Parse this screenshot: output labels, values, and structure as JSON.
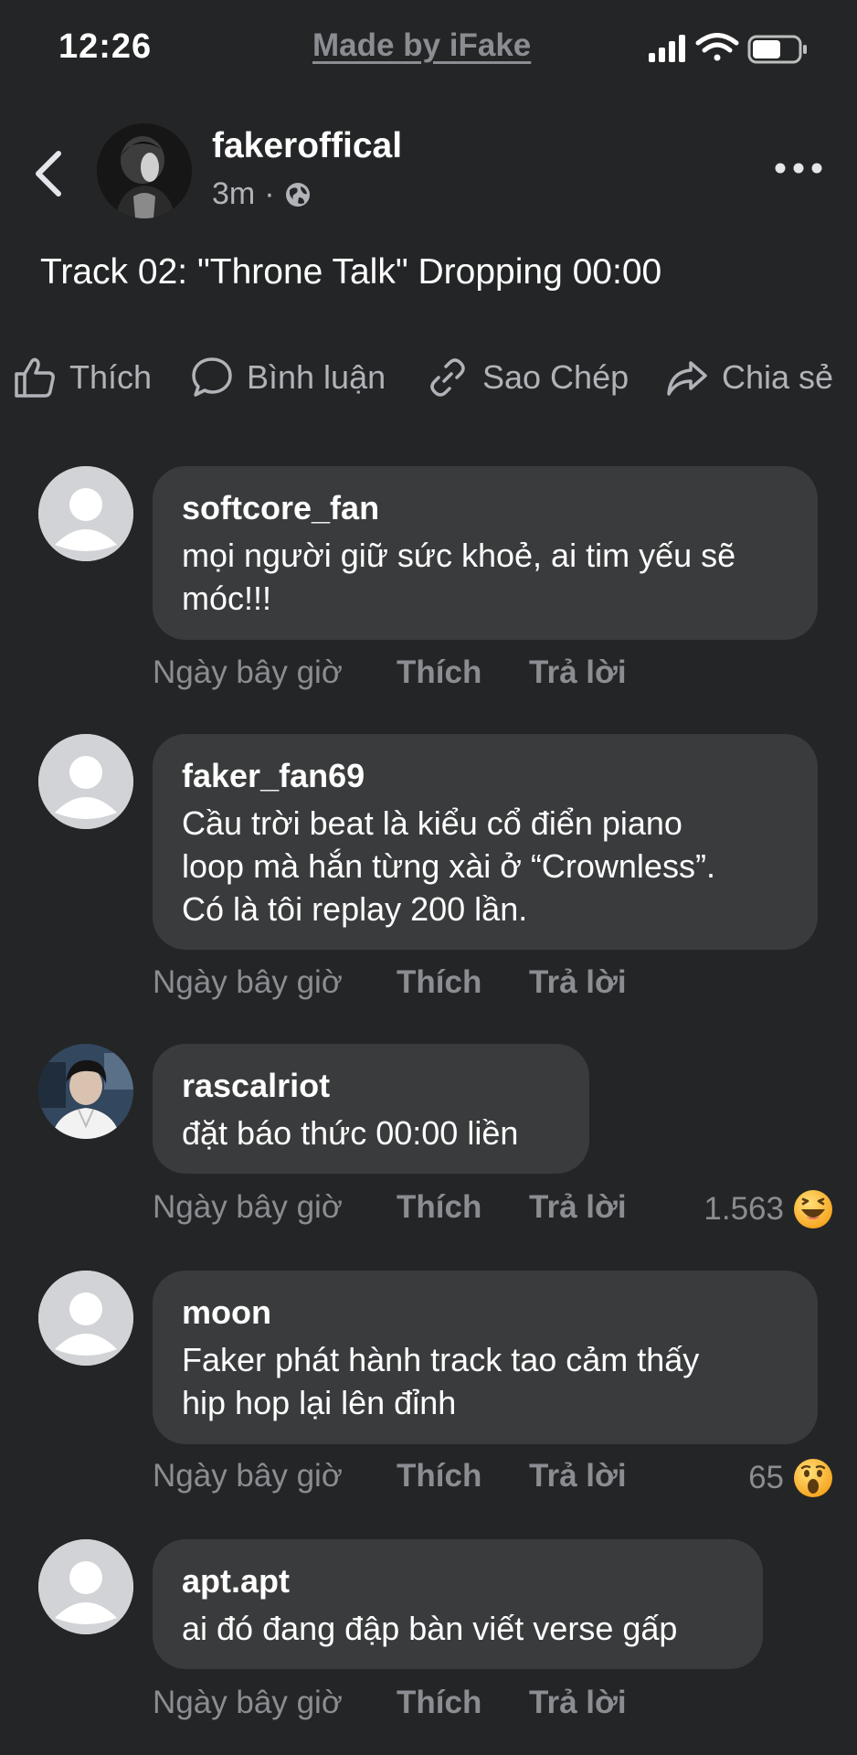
{
  "status_bar": {
    "time": "12:26",
    "center_text": "Made by iFake",
    "icons": [
      "signal-icon",
      "wifi-icon",
      "battery-icon"
    ]
  },
  "post": {
    "author": "fakeroffical",
    "age": "3m",
    "separator": "·",
    "privacy_icon": "globe-icon",
    "text": "Track 02: \"Throne Talk\" Dropping 00:00"
  },
  "actions": {
    "like": "Thích",
    "comment": "Bình luận",
    "copy": "Sao Chép",
    "share": "Chia sẻ"
  },
  "comments": [
    {
      "name": "softcore_fan",
      "lines": [
        "mọi người giữ sức khoẻ, ai tim yếu sẽ",
        "móc!!!"
      ],
      "time": "Ngày bây giờ",
      "like": "Thích",
      "reply": "Trả lời",
      "reaction_count": "",
      "reaction": ""
    },
    {
      "name": "faker_fan69",
      "lines": [
        "Cầu trời beat là kiểu cổ điển piano",
        "loop mà hắn từng xài ở “Crownless”.",
        "Có là tôi replay 200 lần."
      ],
      "time": "Ngày bây giờ",
      "like": "Thích",
      "reply": "Trả lời",
      "reaction_count": "",
      "reaction": ""
    },
    {
      "name": "rascalriot",
      "lines": [
        "đặt báo thức 00:00 liền"
      ],
      "time": "Ngày bây giờ",
      "like": "Thích",
      "reply": "Trả lời",
      "reaction_count": "1.563",
      "reaction": "haha-emoji"
    },
    {
      "name": "moon",
      "lines": [
        "Faker phát hành track tao cảm thấy",
        "hip hop lại lên đỉnh"
      ],
      "time": "Ngày bây giờ",
      "like": "Thích",
      "reply": "Trả lời",
      "reaction_count": "65",
      "reaction": "wow-emoji"
    },
    {
      "name": "apt.apt",
      "lines": [
        "ai đó đang đập bàn viết verse gấp"
      ],
      "time": "Ngày bây giờ",
      "like": "Thích",
      "reply": "Trả lời",
      "reaction_count": "",
      "reaction": ""
    }
  ]
}
